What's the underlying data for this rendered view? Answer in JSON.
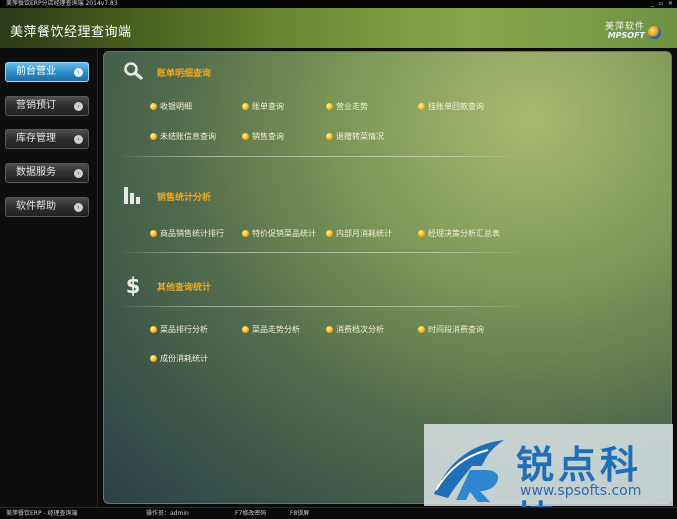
{
  "window": {
    "title": "美萍餐饮ERP分店经理查询端 2014v7.83",
    "controls": {
      "minimize": "_",
      "restore": "▫",
      "close": "✕"
    }
  },
  "header": {
    "app_title": "美萍餐饮经理查询端",
    "brand_cn": "美萍软件",
    "brand_en": "MPSOFT"
  },
  "sidebar": {
    "items": [
      {
        "label": "前台营业",
        "active": true
      },
      {
        "label": "营销预订",
        "active": false
      },
      {
        "label": "库存管理",
        "active": false
      },
      {
        "label": "数据服务",
        "active": false
      },
      {
        "label": "软件帮助",
        "active": false
      }
    ],
    "arrow_glyph": "›"
  },
  "sections": [
    {
      "title": "账单明细查询",
      "icon": "search-icon",
      "links": [
        "收银明细",
        "账单查询",
        "营业走势",
        "挂账单回款查询",
        "未结账信息查询",
        "销售查询",
        "退赠转菜情况"
      ]
    },
    {
      "title": "销售统计分析",
      "icon": "bar-chart-icon",
      "links": [
        "商品销售统计排行",
        "特价促销菜品统计",
        "内部月消耗统计",
        "经理决策分析汇总表"
      ]
    },
    {
      "title": "其他查询统计",
      "icon": "dollar-icon",
      "links": [
        "菜品排行分析",
        "菜品走势分析",
        "消费档次分析",
        "时间段消费查询",
        "成份消耗统计"
      ]
    }
  ],
  "watermark": {
    "cn": "锐点科技",
    "url": "www.spsofts.com"
  },
  "statusbar": {
    "app": "美萍餐饮ERP - 经理查询端",
    "operator": "操作员：admin",
    "f7": "F7修改密码",
    "f8": "F8锁屏"
  },
  "colors": {
    "section_title": "#f2a624",
    "active_nav": "#2f8dc9",
    "link_text": "#f5f0d8"
  }
}
